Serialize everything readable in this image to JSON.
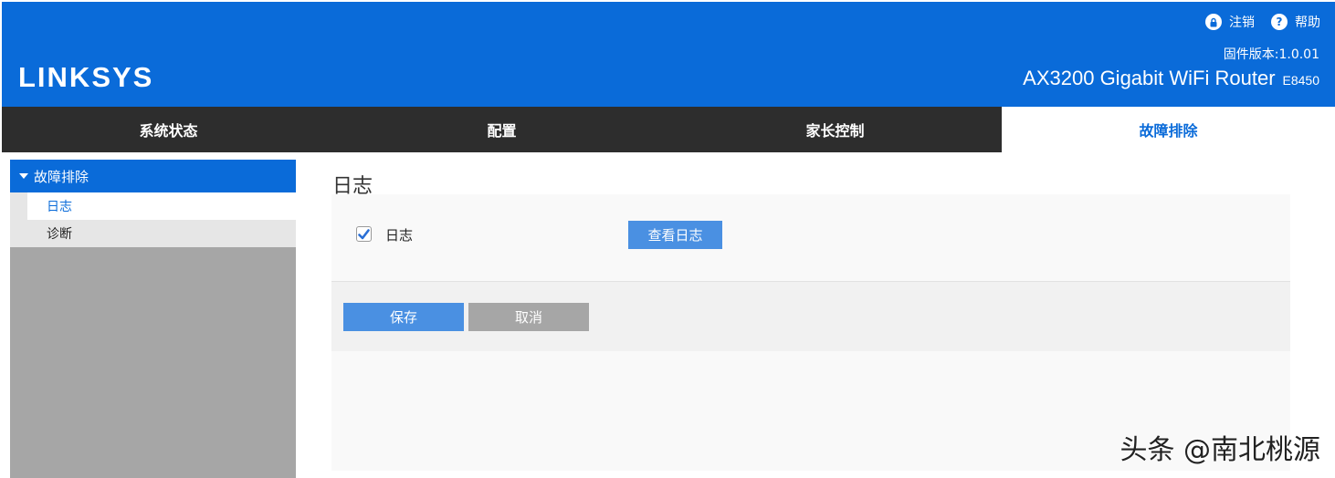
{
  "header": {
    "logo": "LINKSYS",
    "logout_label": "注销",
    "help_label": "帮助",
    "firmware": "固件版本:1.0.01",
    "model_name": "AX3200 Gigabit WiFi Router",
    "model_code": "E8450",
    "background_color": "#0a6bd9"
  },
  "nav": {
    "tabs": [
      {
        "label": "系统状态"
      },
      {
        "label": "配置"
      },
      {
        "label": "家长控制"
      },
      {
        "label": "故障排除",
        "active": true
      }
    ]
  },
  "sidebar": {
    "section_label": "故障排除",
    "items": [
      {
        "label": "日志",
        "active": true
      },
      {
        "label": "诊断"
      }
    ]
  },
  "main": {
    "title": "日志",
    "log_checkbox": {
      "label": "日志",
      "checked": true
    },
    "view_log_button": "查看日志",
    "save_button": "保存",
    "cancel_button": "取消"
  },
  "watermark": "头条 @南北桃源",
  "icons": [
    "lock-icon",
    "help-icon",
    "caret-down-icon",
    "checkmark-icon"
  ]
}
